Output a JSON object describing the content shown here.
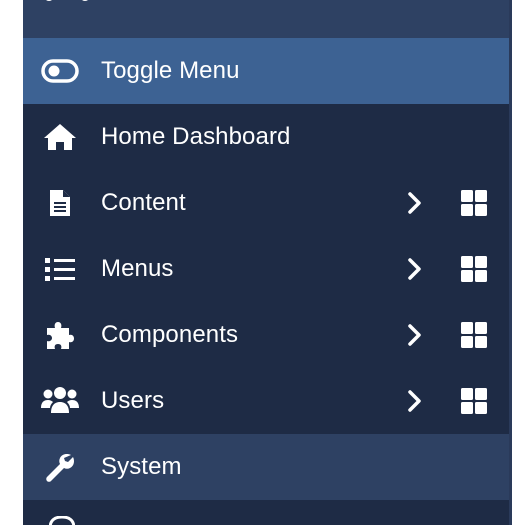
{
  "sidebar": {
    "items": [
      {
        "label": "Toggle Menu",
        "icon": "toggle-icon"
      },
      {
        "label": "Home Dashboard",
        "icon": "home-icon"
      },
      {
        "label": "Content",
        "icon": "file-icon"
      },
      {
        "label": "Menus",
        "icon": "list-icon"
      },
      {
        "label": "Components",
        "icon": "puzzle-icon"
      },
      {
        "label": "Users",
        "icon": "users-icon"
      },
      {
        "label": "System",
        "icon": "wrench-icon"
      }
    ]
  },
  "colors": {
    "sidebar_bg": "#1e2b45",
    "active_bg": "#3d6293",
    "hover_bg": "#2e4163",
    "text": "#ffffff"
  }
}
